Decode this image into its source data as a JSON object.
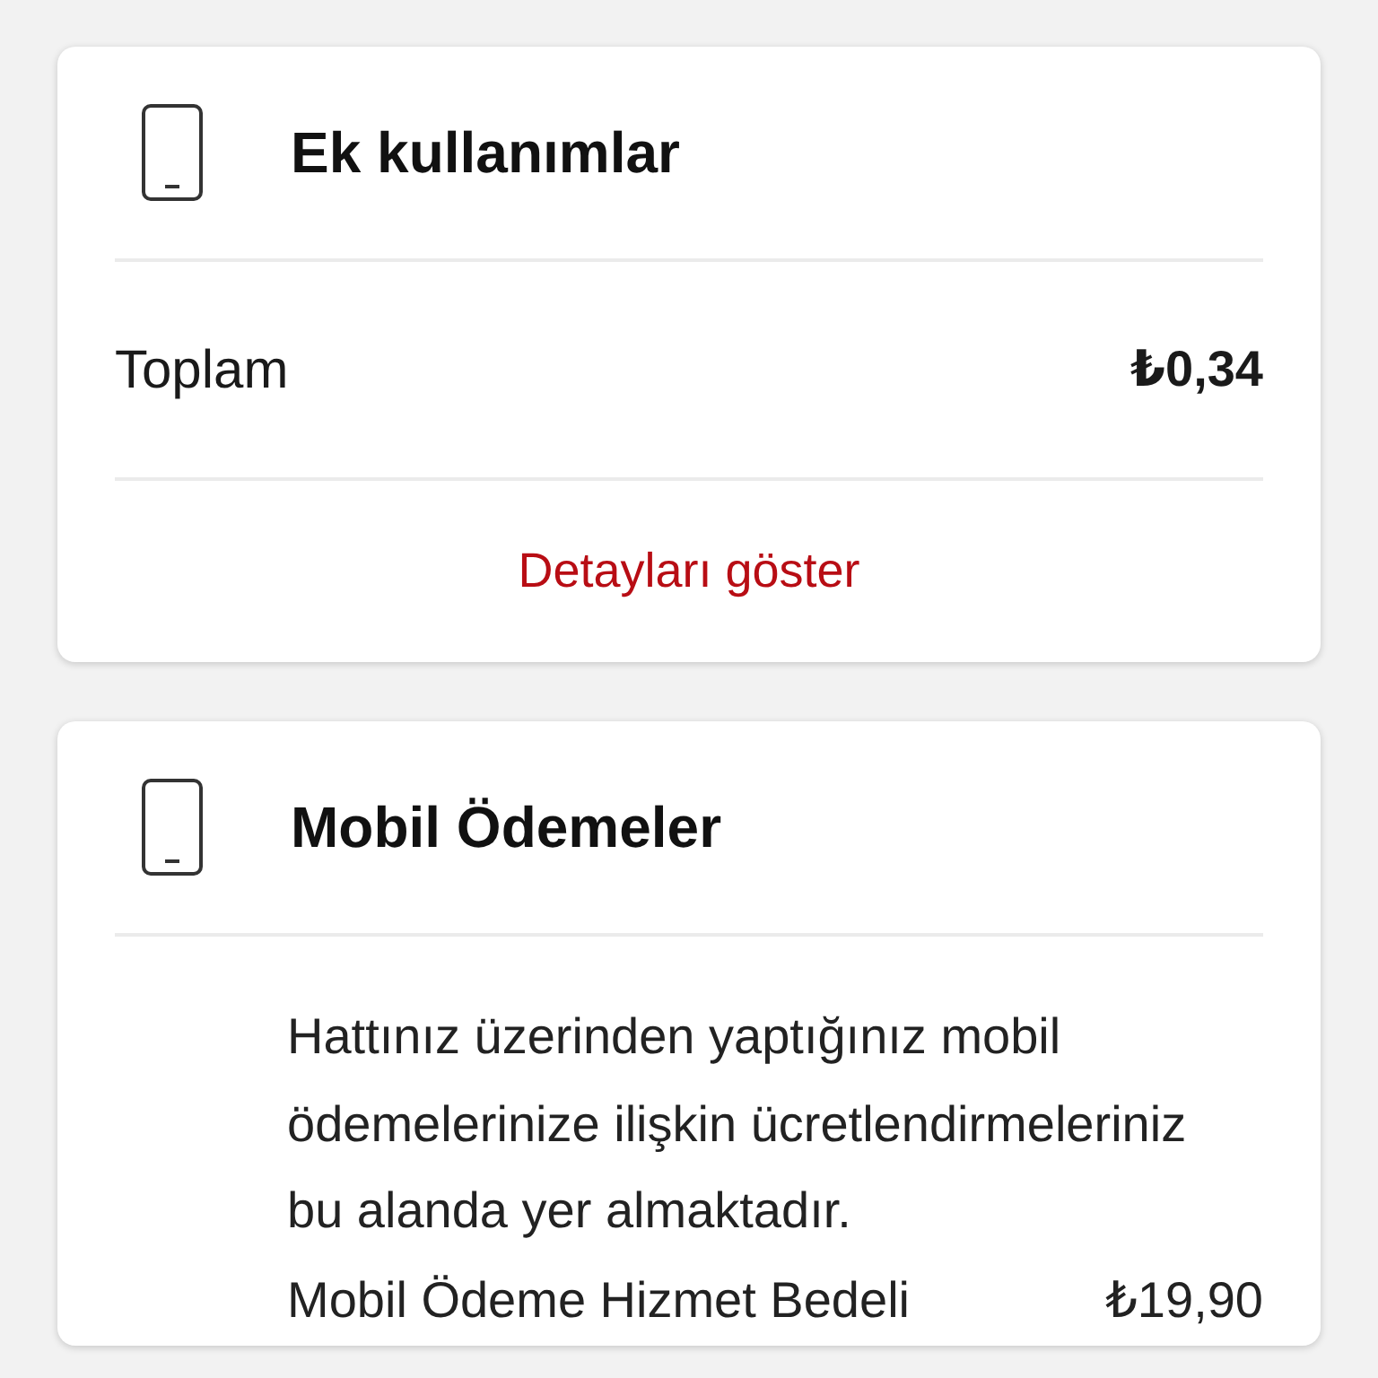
{
  "cards": [
    {
      "title": "Ek kullanımlar",
      "rows": [
        {
          "kind": "total",
          "label": "Toplam",
          "amount": "₺0,34"
        }
      ],
      "link": "Detayları göster"
    },
    {
      "title": "Mobil Ödemeler",
      "description": "Hattınız üzerinden yaptığınız mobil ödemelerinize ilişkin ücretlendirmeleriniz bu alanda yer almaktadır.",
      "rows": [
        {
          "kind": "item",
          "label": "Mobil Ödeme Hizmet Bedeli",
          "amount": "₺19,90"
        }
      ]
    }
  ]
}
